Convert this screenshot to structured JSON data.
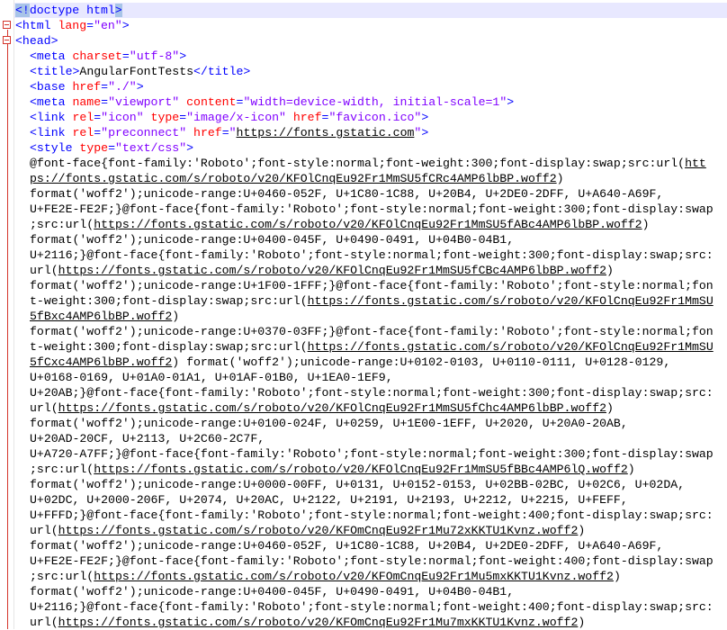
{
  "editor": {
    "lines": [
      {
        "highlight": true,
        "indent": 0,
        "segments": [
          {
            "t": "sel",
            "s": "<!"
          },
          {
            "t": "tag",
            "s": "doctype html"
          },
          {
            "t": "sel",
            "s": ">"
          }
        ]
      },
      {
        "highlight": false,
        "indent": 0,
        "segments": [
          {
            "t": "tag",
            "s": "<html "
          },
          {
            "t": "attr",
            "s": "lang"
          },
          {
            "t": "tag",
            "s": "="
          },
          {
            "t": "val",
            "s": "\"en\""
          },
          {
            "t": "tag",
            "s": ">"
          }
        ]
      },
      {
        "highlight": false,
        "indent": 0,
        "segments": [
          {
            "t": "tag",
            "s": "<head>"
          }
        ]
      },
      {
        "highlight": false,
        "indent": 1,
        "segments": [
          {
            "t": "tag",
            "s": "<meta "
          },
          {
            "t": "attr",
            "s": "charset"
          },
          {
            "t": "tag",
            "s": "="
          },
          {
            "t": "val",
            "s": "\"utf-8\""
          },
          {
            "t": "tag",
            "s": ">"
          }
        ]
      },
      {
        "highlight": false,
        "indent": 1,
        "segments": [
          {
            "t": "tag",
            "s": "<title>"
          },
          {
            "t": "txt",
            "s": "AngularFontTests"
          },
          {
            "t": "tag",
            "s": "</title>"
          }
        ]
      },
      {
        "highlight": false,
        "indent": 1,
        "segments": [
          {
            "t": "tag",
            "s": "<base "
          },
          {
            "t": "attr",
            "s": "href"
          },
          {
            "t": "tag",
            "s": "="
          },
          {
            "t": "val",
            "s": "\"./\""
          },
          {
            "t": "tag",
            "s": ">"
          }
        ]
      },
      {
        "highlight": false,
        "indent": 1,
        "segments": [
          {
            "t": "tag",
            "s": "<meta "
          },
          {
            "t": "attr",
            "s": "name"
          },
          {
            "t": "tag",
            "s": "="
          },
          {
            "t": "val",
            "s": "\"viewport\""
          },
          {
            "t": "attr",
            "s": " content"
          },
          {
            "t": "tag",
            "s": "="
          },
          {
            "t": "val",
            "s": "\"width=device-width, initial-scale=1\""
          },
          {
            "t": "tag",
            "s": ">"
          }
        ]
      },
      {
        "highlight": false,
        "indent": 1,
        "segments": [
          {
            "t": "tag",
            "s": "<link "
          },
          {
            "t": "attr",
            "s": "rel"
          },
          {
            "t": "tag",
            "s": "="
          },
          {
            "t": "val",
            "s": "\"icon\""
          },
          {
            "t": "attr",
            "s": " type"
          },
          {
            "t": "tag",
            "s": "="
          },
          {
            "t": "val",
            "s": "\"image/x-icon\""
          },
          {
            "t": "attr",
            "s": " href"
          },
          {
            "t": "tag",
            "s": "="
          },
          {
            "t": "val",
            "s": "\"favicon.ico\""
          },
          {
            "t": "tag",
            "s": ">"
          }
        ]
      },
      {
        "highlight": false,
        "indent": 1,
        "segments": [
          {
            "t": "tag",
            "s": "<link "
          },
          {
            "t": "attr",
            "s": "rel"
          },
          {
            "t": "tag",
            "s": "="
          },
          {
            "t": "val",
            "s": "\"preconnect\""
          },
          {
            "t": "attr",
            "s": " href"
          },
          {
            "t": "tag",
            "s": "="
          },
          {
            "t": "val",
            "s": "\""
          },
          {
            "t": "link",
            "s": "https://fonts.gstatic.com"
          },
          {
            "t": "val",
            "s": "\""
          },
          {
            "t": "tag",
            "s": ">"
          }
        ]
      },
      {
        "highlight": false,
        "indent": 1,
        "segments": [
          {
            "t": "tag",
            "s": "<style "
          },
          {
            "t": "attr",
            "s": "type"
          },
          {
            "t": "tag",
            "s": "="
          },
          {
            "t": "val",
            "s": "\"text/css\""
          },
          {
            "t": "tag",
            "s": ">"
          }
        ]
      },
      {
        "highlight": false,
        "indent": 1,
        "segments": [
          {
            "t": "txt",
            "s": "@font-face{font-family:'Roboto';font-style:normal;font-weight:300;font-display:swap;src:url("
          },
          {
            "t": "link",
            "s": "htt"
          }
        ]
      },
      {
        "highlight": false,
        "indent": 1,
        "segments": [
          {
            "t": "link",
            "s": "ps://fonts.gstatic.com/s/roboto/v20/KFOlCnqEu92Fr1MmSU5fCRc4AMP6lbBP.woff2"
          },
          {
            "t": "txt",
            "s": ")"
          }
        ]
      },
      {
        "highlight": false,
        "indent": 1,
        "segments": [
          {
            "t": "txt",
            "s": "format('woff2');unicode-range:U+0460-052F, U+1C80-1C88, U+20B4, U+2DE0-2DFF, U+A640-A69F,"
          }
        ]
      },
      {
        "highlight": false,
        "indent": 1,
        "segments": [
          {
            "t": "txt",
            "s": "U+FE2E-FE2F;}@font-face{font-family:'Roboto';font-style:normal;font-weight:300;font-display:swap"
          }
        ]
      },
      {
        "highlight": false,
        "indent": 1,
        "segments": [
          {
            "t": "txt",
            "s": ";src:url("
          },
          {
            "t": "link",
            "s": "https://fonts.gstatic.com/s/roboto/v20/KFOlCnqEu92Fr1MmSU5fABc4AMP6lbBP.woff2"
          },
          {
            "t": "txt",
            "s": ")"
          }
        ]
      },
      {
        "highlight": false,
        "indent": 1,
        "segments": [
          {
            "t": "txt",
            "s": "format('woff2');unicode-range:U+0400-045F, U+0490-0491, U+04B0-04B1,"
          }
        ]
      },
      {
        "highlight": false,
        "indent": 1,
        "segments": [
          {
            "t": "txt",
            "s": "U+2116;}@font-face{font-family:'Roboto';font-style:normal;font-weight:300;font-display:swap;src:"
          }
        ]
      },
      {
        "highlight": false,
        "indent": 1,
        "segments": [
          {
            "t": "txt",
            "s": "url("
          },
          {
            "t": "link",
            "s": "https://fonts.gstatic.com/s/roboto/v20/KFOlCnqEu92Fr1MmSU5fCBc4AMP6lbBP.woff2"
          },
          {
            "t": "txt",
            "s": ")"
          }
        ]
      },
      {
        "highlight": false,
        "indent": 1,
        "segments": [
          {
            "t": "txt",
            "s": "format('woff2');unicode-range:U+1F00-1FFF;}@font-face{font-family:'Roboto';font-style:normal;fon"
          }
        ]
      },
      {
        "highlight": false,
        "indent": 1,
        "segments": [
          {
            "t": "txt",
            "s": "t-weight:300;font-display:swap;src:url("
          },
          {
            "t": "link",
            "s": "https://fonts.gstatic.com/s/roboto/v20/KFOlCnqEu92Fr1MmSU"
          }
        ]
      },
      {
        "highlight": false,
        "indent": 1,
        "segments": [
          {
            "t": "link",
            "s": "5fBxc4AMP6lbBP.woff2"
          },
          {
            "t": "txt",
            "s": ")"
          }
        ]
      },
      {
        "highlight": false,
        "indent": 1,
        "segments": [
          {
            "t": "txt",
            "s": "format('woff2');unicode-range:U+0370-03FF;}@font-face{font-family:'Roboto';font-style:normal;fon"
          }
        ]
      },
      {
        "highlight": false,
        "indent": 1,
        "segments": [
          {
            "t": "txt",
            "s": "t-weight:300;font-display:swap;src:url("
          },
          {
            "t": "link",
            "s": "https://fonts.gstatic.com/s/roboto/v20/KFOlCnqEu92Fr1MmSU"
          }
        ]
      },
      {
        "highlight": false,
        "indent": 1,
        "segments": [
          {
            "t": "link",
            "s": "5fCxc4AMP6lbBP.woff2"
          },
          {
            "t": "txt",
            "s": ") format('woff2');unicode-range:U+0102-0103, U+0110-0111, U+0128-0129,"
          }
        ]
      },
      {
        "highlight": false,
        "indent": 1,
        "segments": [
          {
            "t": "txt",
            "s": "U+0168-0169, U+01A0-01A1, U+01AF-01B0, U+1EA0-1EF9,"
          }
        ]
      },
      {
        "highlight": false,
        "indent": 1,
        "segments": [
          {
            "t": "txt",
            "s": "U+20AB;}@font-face{font-family:'Roboto';font-style:normal;font-weight:300;font-display:swap;src:"
          }
        ]
      },
      {
        "highlight": false,
        "indent": 1,
        "segments": [
          {
            "t": "txt",
            "s": "url("
          },
          {
            "t": "link",
            "s": "https://fonts.gstatic.com/s/roboto/v20/KFOlCnqEu92Fr1MmSU5fChc4AMP6lbBP.woff2"
          },
          {
            "t": "txt",
            "s": ")"
          }
        ]
      },
      {
        "highlight": false,
        "indent": 1,
        "segments": [
          {
            "t": "txt",
            "s": "format('woff2');unicode-range:U+0100-024F, U+0259, U+1E00-1EFF, U+2020, U+20A0-20AB,"
          }
        ]
      },
      {
        "highlight": false,
        "indent": 1,
        "segments": [
          {
            "t": "txt",
            "s": "U+20AD-20CF, U+2113, U+2C60-2C7F,"
          }
        ]
      },
      {
        "highlight": false,
        "indent": 1,
        "segments": [
          {
            "t": "txt",
            "s": "U+A720-A7FF;}@font-face{font-family:'Roboto';font-style:normal;font-weight:300;font-display:swap"
          }
        ]
      },
      {
        "highlight": false,
        "indent": 1,
        "segments": [
          {
            "t": "txt",
            "s": ";src:url("
          },
          {
            "t": "link",
            "s": "https://fonts.gstatic.com/s/roboto/v20/KFOlCnqEu92Fr1MmSU5fBBc4AMP6lQ.woff2"
          },
          {
            "t": "txt",
            "s": ")"
          }
        ]
      },
      {
        "highlight": false,
        "indent": 1,
        "segments": [
          {
            "t": "txt",
            "s": "format('woff2');unicode-range:U+0000-00FF, U+0131, U+0152-0153, U+02BB-02BC, U+02C6, U+02DA,"
          }
        ]
      },
      {
        "highlight": false,
        "indent": 1,
        "segments": [
          {
            "t": "txt",
            "s": "U+02DC, U+2000-206F, U+2074, U+20AC, U+2122, U+2191, U+2193, U+2212, U+2215, U+FEFF,"
          }
        ]
      },
      {
        "highlight": false,
        "indent": 1,
        "segments": [
          {
            "t": "txt",
            "s": "U+FFFD;}@font-face{font-family:'Roboto';font-style:normal;font-weight:400;font-display:swap;src:"
          }
        ]
      },
      {
        "highlight": false,
        "indent": 1,
        "segments": [
          {
            "t": "txt",
            "s": "url("
          },
          {
            "t": "link",
            "s": "https://fonts.gstatic.com/s/roboto/v20/KFOmCnqEu92Fr1Mu72xKKTU1Kvnz.woff2"
          },
          {
            "t": "txt",
            "s": ")"
          }
        ]
      },
      {
        "highlight": false,
        "indent": 1,
        "segments": [
          {
            "t": "txt",
            "s": "format('woff2');unicode-range:U+0460-052F, U+1C80-1C88, U+20B4, U+2DE0-2DFF, U+A640-A69F,"
          }
        ]
      },
      {
        "highlight": false,
        "indent": 1,
        "segments": [
          {
            "t": "txt",
            "s": "U+FE2E-FE2F;}@font-face{font-family:'Roboto';font-style:normal;font-weight:400;font-display:swap"
          }
        ]
      },
      {
        "highlight": false,
        "indent": 1,
        "segments": [
          {
            "t": "txt",
            "s": ";src:url("
          },
          {
            "t": "link",
            "s": "https://fonts.gstatic.com/s/roboto/v20/KFOmCnqEu92Fr1Mu5mxKKTU1Kvnz.woff2"
          },
          {
            "t": "txt",
            "s": ")"
          }
        ]
      },
      {
        "highlight": false,
        "indent": 1,
        "segments": [
          {
            "t": "txt",
            "s": "format('woff2');unicode-range:U+0400-045F, U+0490-0491, U+04B0-04B1,"
          }
        ]
      },
      {
        "highlight": false,
        "indent": 1,
        "segments": [
          {
            "t": "txt",
            "s": "U+2116;}@font-face{font-family:'Roboto';font-style:normal;font-weight:400;font-display:swap;src:"
          }
        ]
      },
      {
        "highlight": false,
        "indent": 1,
        "segments": [
          {
            "t": "txt",
            "s": "url("
          },
          {
            "t": "link",
            "s": "https://fonts.gstatic.com/s/roboto/v20/KFOmCnqEu92Fr1Mu7mxKKTU1Kvnz.woff2"
          },
          {
            "t": "txt",
            "s": ")"
          }
        ]
      }
    ]
  }
}
